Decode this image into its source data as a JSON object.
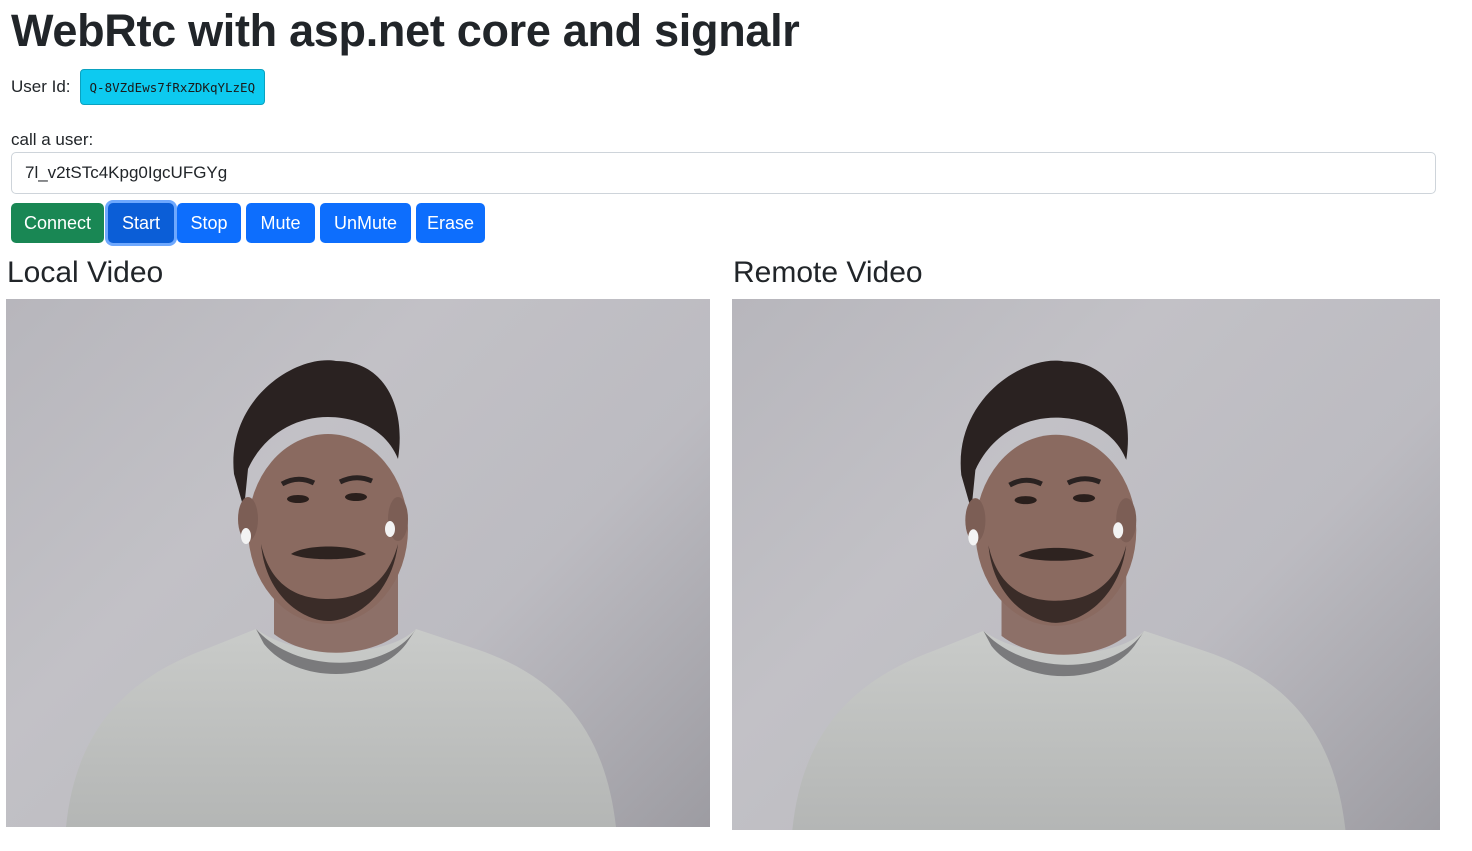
{
  "page": {
    "title": "WebRtc with asp.net core and signalr"
  },
  "user": {
    "label": "User Id:",
    "id": "Q-8VZdEws7fRxZDKqYLzEQ"
  },
  "call": {
    "label": "call a user:",
    "value": "7l_v2tSTc4Kpg0IgcUFGYg"
  },
  "buttons": {
    "connect": "Connect",
    "start": "Start",
    "stop": "Stop",
    "mute": "Mute",
    "unmute": "UnMute",
    "erase": "Erase"
  },
  "videos": {
    "local_title": "Local Video",
    "remote_title": "Remote Video"
  },
  "colors": {
    "success": "#198754",
    "primary": "#0d6efd",
    "info": "#0dcaf0"
  }
}
